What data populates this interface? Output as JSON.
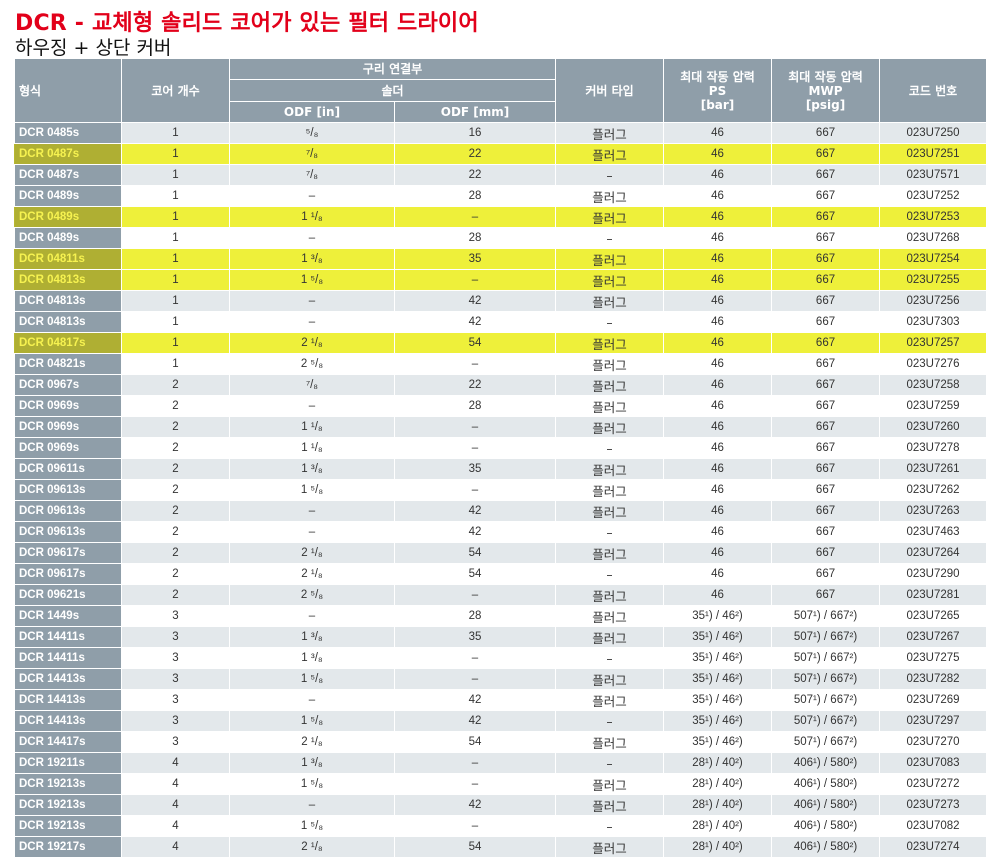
{
  "title": "DCR - 교체형 솔리드 코어가 있는 필터 드라이어",
  "subtitle": "하우징 + 상단 커버",
  "headers": {
    "model": "형식",
    "cores": "코어 개수",
    "connection": "구리 연결부",
    "solder": "솔더",
    "odf_in": "ODF [in]",
    "odf_mm": "ODF [mm]",
    "cover": "커버 타입",
    "ps_l1": "최대 작동 압력",
    "ps_l2": "PS",
    "ps_l3": "[bar]",
    "mwp_l1": "최대 작동 압력",
    "mwp_l2": "MWP",
    "mwp_l3": "[psig]",
    "code": "코드 번호"
  },
  "highlight_color": "#eef03a",
  "header_color": "#8f9ea9",
  "title_color": "#e2001a",
  "rows": [
    {
      "model": "DCR 0485s",
      "cores": "1",
      "odf_in": "⁵/₈",
      "odf_mm": "16",
      "cover": "플러그",
      "ps": "46",
      "mwp": "667",
      "code": "023U7250",
      "hl": false
    },
    {
      "model": "DCR 0487s",
      "cores": "1",
      "odf_in": "⁷/₈",
      "odf_mm": "22",
      "cover": "플러그",
      "ps": "46",
      "mwp": "667",
      "code": "023U7251",
      "hl": true
    },
    {
      "model": "DCR 0487s",
      "cores": "1",
      "odf_in": "⁷/₈",
      "odf_mm": "22",
      "cover": "–",
      "ps": "46",
      "mwp": "667",
      "code": "023U7571",
      "hl": false
    },
    {
      "model": "DCR 0489s",
      "cores": "1",
      "odf_in": "–",
      "odf_mm": "28",
      "cover": "플러그",
      "ps": "46",
      "mwp": "667",
      "code": "023U7252",
      "hl": false
    },
    {
      "model": "DCR 0489s",
      "cores": "1",
      "odf_in": "1 ¹/₈",
      "odf_mm": "–",
      "cover": "플러그",
      "ps": "46",
      "mwp": "667",
      "code": "023U7253",
      "hl": true
    },
    {
      "model": "DCR 0489s",
      "cores": "1",
      "odf_in": "–",
      "odf_mm": "28",
      "cover": "–",
      "ps": "46",
      "mwp": "667",
      "code": "023U7268",
      "hl": false
    },
    {
      "model": "DCR 04811s",
      "cores": "1",
      "odf_in": "1 ³/₈",
      "odf_mm": "35",
      "cover": "플러그",
      "ps": "46",
      "mwp": "667",
      "code": "023U7254",
      "hl": true
    },
    {
      "model": "DCR 04813s",
      "cores": "1",
      "odf_in": "1 ⁵/₈",
      "odf_mm": "–",
      "cover": "플러그",
      "ps": "46",
      "mwp": "667",
      "code": "023U7255",
      "hl": true
    },
    {
      "model": "DCR 04813s",
      "cores": "1",
      "odf_in": "–",
      "odf_mm": "42",
      "cover": "플러그",
      "ps": "46",
      "mwp": "667",
      "code": "023U7256",
      "hl": false
    },
    {
      "model": "DCR 04813s",
      "cores": "1",
      "odf_in": "–",
      "odf_mm": "42",
      "cover": "–",
      "ps": "46",
      "mwp": "667",
      "code": "023U7303",
      "hl": false
    },
    {
      "model": "DCR 04817s",
      "cores": "1",
      "odf_in": "2 ¹/₈",
      "odf_mm": "54",
      "cover": "플러그",
      "ps": "46",
      "mwp": "667",
      "code": "023U7257",
      "hl": true
    },
    {
      "model": "DCR 04821s",
      "cores": "1",
      "odf_in": "2 ⁵/₈",
      "odf_mm": "–",
      "cover": "플러그",
      "ps": "46",
      "mwp": "667",
      "code": "023U7276",
      "hl": false
    },
    {
      "model": "DCR 0967s",
      "cores": "2",
      "odf_in": "⁷/₈",
      "odf_mm": "22",
      "cover": "플러그",
      "ps": "46",
      "mwp": "667",
      "code": "023U7258",
      "hl": false
    },
    {
      "model": "DCR 0969s",
      "cores": "2",
      "odf_in": "–",
      "odf_mm": "28",
      "cover": "플러그",
      "ps": "46",
      "mwp": "667",
      "code": "023U7259",
      "hl": false
    },
    {
      "model": "DCR 0969s",
      "cores": "2",
      "odf_in": "1 ¹/₈",
      "odf_mm": "–",
      "cover": "플러그",
      "ps": "46",
      "mwp": "667",
      "code": "023U7260",
      "hl": false
    },
    {
      "model": "DCR 0969s",
      "cores": "2",
      "odf_in": "1 ¹/₈",
      "odf_mm": "–",
      "cover": "–",
      "ps": "46",
      "mwp": "667",
      "code": "023U7278",
      "hl": false
    },
    {
      "model": "DCR 09611s",
      "cores": "2",
      "odf_in": "1 ³/₈",
      "odf_mm": "35",
      "cover": "플러그",
      "ps": "46",
      "mwp": "667",
      "code": "023U7261",
      "hl": false
    },
    {
      "model": "DCR 09613s",
      "cores": "2",
      "odf_in": "1 ⁵/₈",
      "odf_mm": "–",
      "cover": "플러그",
      "ps": "46",
      "mwp": "667",
      "code": "023U7262",
      "hl": false
    },
    {
      "model": "DCR 09613s",
      "cores": "2",
      "odf_in": "–",
      "odf_mm": "42",
      "cover": "플러그",
      "ps": "46",
      "mwp": "667",
      "code": "023U7263",
      "hl": false
    },
    {
      "model": "DCR 09613s",
      "cores": "2",
      "odf_in": "–",
      "odf_mm": "42",
      "cover": "–",
      "ps": "46",
      "mwp": "667",
      "code": "023U7463",
      "hl": false
    },
    {
      "model": "DCR 09617s",
      "cores": "2",
      "odf_in": "2 ¹/₈",
      "odf_mm": "54",
      "cover": "플러그",
      "ps": "46",
      "mwp": "667",
      "code": "023U7264",
      "hl": false
    },
    {
      "model": "DCR 09617s",
      "cores": "2",
      "odf_in": "2 ¹/₈",
      "odf_mm": "54",
      "cover": "–",
      "ps": "46",
      "mwp": "667",
      "code": "023U7290",
      "hl": false
    },
    {
      "model": "DCR 09621s",
      "cores": "2",
      "odf_in": "2 ⁵/₈",
      "odf_mm": "–",
      "cover": "플러그",
      "ps": "46",
      "mwp": "667",
      "code": "023U7281",
      "hl": false
    },
    {
      "model": "DCR 1449s",
      "cores": "3",
      "odf_in": "–",
      "odf_mm": "28",
      "cover": "플러그",
      "ps": "35¹) / 46²)",
      "mwp": "507¹) / 667²)",
      "code": "023U7265",
      "hl": false
    },
    {
      "model": "DCR 14411s",
      "cores": "3",
      "odf_in": "1 ³/₈",
      "odf_mm": "35",
      "cover": "플러그",
      "ps": "35¹) / 46²)",
      "mwp": "507¹) / 667²)",
      "code": "023U7267",
      "hl": false
    },
    {
      "model": "DCR 14411s",
      "cores": "3",
      "odf_in": "1 ³/₈",
      "odf_mm": "–",
      "cover": "–",
      "ps": "35¹) / 46²)",
      "mwp": "507¹) / 667²)",
      "code": "023U7275",
      "hl": false
    },
    {
      "model": "DCR 14413s",
      "cores": "3",
      "odf_in": "1 ⁵/₈",
      "odf_mm": "–",
      "cover": "플러그",
      "ps": "35¹) / 46²)",
      "mwp": "507¹) / 667²)",
      "code": "023U7282",
      "hl": false
    },
    {
      "model": "DCR 14413s",
      "cores": "3",
      "odf_in": "–",
      "odf_mm": "42",
      "cover": "플러그",
      "ps": "35¹) / 46²)",
      "mwp": "507¹) / 667²)",
      "code": "023U7269",
      "hl": false
    },
    {
      "model": "DCR 14413s",
      "cores": "3",
      "odf_in": "1 ⁵/₈",
      "odf_mm": "42",
      "cover": "–",
      "ps": "35¹) / 46²)",
      "mwp": "507¹) / 667²)",
      "code": "023U7297",
      "hl": false
    },
    {
      "model": "DCR 14417s",
      "cores": "3",
      "odf_in": "2 ¹/₈",
      "odf_mm": "54",
      "cover": "플러그",
      "ps": "35¹) / 46²)",
      "mwp": "507¹) / 667²)",
      "code": "023U7270",
      "hl": false
    },
    {
      "model": "DCR 19211s",
      "cores": "4",
      "odf_in": "1 ³/₈",
      "odf_mm": "–",
      "cover": "–",
      "ps": "28¹) / 40²)",
      "mwp": "406¹) / 580²)",
      "code": "023U7083",
      "hl": false
    },
    {
      "model": "DCR 19213s",
      "cores": "4",
      "odf_in": "1 ⁵/₈",
      "odf_mm": "–",
      "cover": "플러그",
      "ps": "28¹) / 40²)",
      "mwp": "406¹) / 580²)",
      "code": "023U7272",
      "hl": false
    },
    {
      "model": "DCR 19213s",
      "cores": "4",
      "odf_in": "–",
      "odf_mm": "42",
      "cover": "플러그",
      "ps": "28¹) / 40²)",
      "mwp": "406¹) / 580²)",
      "code": "023U7273",
      "hl": false
    },
    {
      "model": "DCR 19213s",
      "cores": "4",
      "odf_in": "1 ⁵/₈",
      "odf_mm": "–",
      "cover": "–",
      "ps": "28¹) / 40²)",
      "mwp": "406¹) / 580²)",
      "code": "023U7082",
      "hl": false
    },
    {
      "model": "DCR 19217s",
      "cores": "4",
      "odf_in": "2 ¹/₈",
      "odf_mm": "54",
      "cover": "플러그",
      "ps": "28¹) / 40²)",
      "mwp": "406¹) / 580²)",
      "code": "023U7274",
      "hl": false
    }
  ]
}
